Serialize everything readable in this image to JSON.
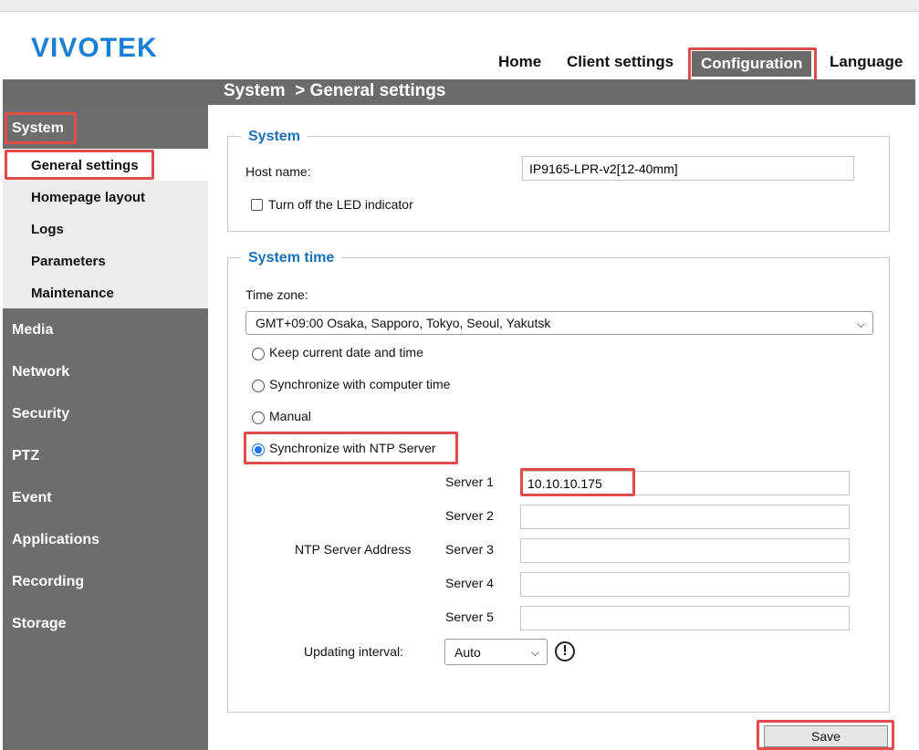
{
  "brand": {
    "logo": "VIVOTEK"
  },
  "nav": {
    "home": "Home",
    "client_settings": "Client settings",
    "configuration": "Configuration",
    "language": "Language"
  },
  "breadcrumb": {
    "section": "System",
    "page": "> General settings"
  },
  "sidebar": {
    "system": "System",
    "sub": [
      "General settings",
      "Homepage layout",
      "Logs",
      "Parameters",
      "Maintenance"
    ],
    "items": [
      "Media",
      "Network",
      "Security",
      "PTZ",
      "Event",
      "Applications",
      "Recording",
      "Storage"
    ]
  },
  "system_box": {
    "legend": "System",
    "host_label": "Host name:",
    "host_value": "IP9165-LPR-v2[12-40mm]",
    "led_label": "Turn off the LED indicator"
  },
  "time_box": {
    "legend": "System time",
    "tz_label": "Time zone:",
    "tz_value": "GMT+09:00 Osaka, Sapporo, Tokyo, Seoul, Yakutsk",
    "options": [
      "Keep current date and time",
      "Synchronize with computer time",
      "Manual",
      "Synchronize with NTP Server"
    ],
    "selected_option": "Synchronize with NTP Server",
    "ntp_address_label": "NTP Server Address",
    "server_labels": [
      "Server 1",
      "Server 2",
      "Server 3",
      "Server 4",
      "Server 5"
    ],
    "server_values": [
      "10.10.10.175",
      "",
      "",
      "",
      ""
    ],
    "interval_label": "Updating interval:",
    "interval_value": "Auto",
    "info_glyph": "!"
  },
  "save_label": "Save",
  "colors": {
    "highlight": "#e04b4b",
    "accent": "#1a6fb6",
    "sidebar": "#6d6d6d",
    "logo": "#1a7fd6"
  }
}
